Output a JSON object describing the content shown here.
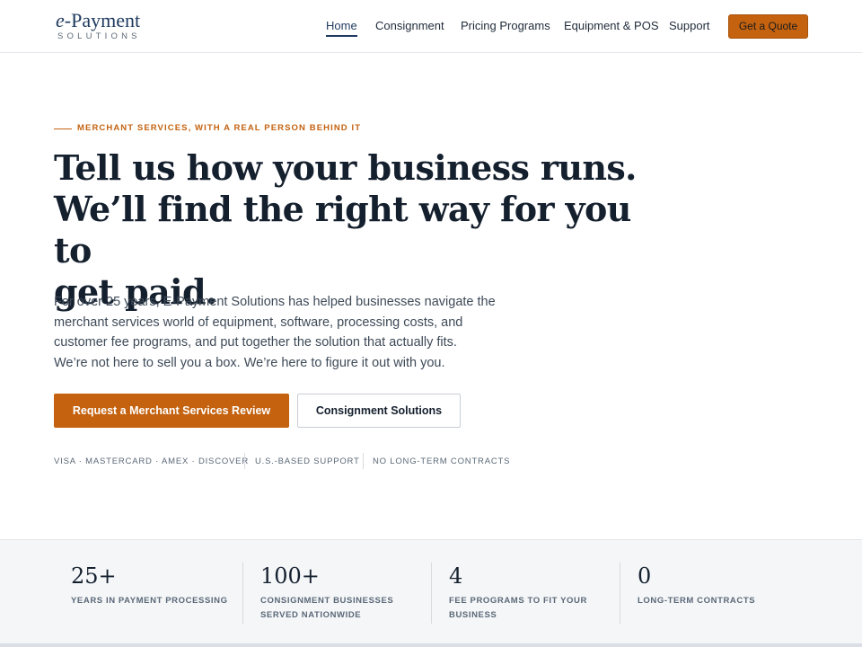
{
  "brand": {
    "logo_prefix": "e",
    "logo_main": "-Payment",
    "logo_sub": "SOLUTIONS"
  },
  "nav": {
    "items": [
      {
        "label": "Home",
        "active": true
      },
      {
        "label": "Consignment",
        "active": false
      },
      {
        "label": "Pricing Programs",
        "active": false
      },
      {
        "label": "Equipment & POS",
        "active": false
      },
      {
        "label": "Support",
        "active": false
      }
    ],
    "cta_label": "Get a Quote"
  },
  "hero": {
    "eyebrow": "MERCHANT SERVICES, WITH A REAL PERSON BEHIND IT",
    "headline_lines": [
      "Tell us how your business runs.",
      "We’ll find the right way for you to",
      "get paid."
    ],
    "body_lines": [
      "For over 25 years, E-Payment Solutions has helped businesses navigate the",
      "merchant services world of equipment, software, processing costs, and",
      "customer fee programs, and put together the solution that actually fits.",
      "We’re not here to sell you a box. We’re here to figure it out with you."
    ],
    "primary_button": "Request a Merchant Services Review",
    "secondary_button": "Consignment Solutions",
    "badges": [
      "VISA · MASTERCARD · AMEX · DISCOVER",
      "U.S.-BASED SUPPORT",
      "NO LONG-TERM CONTRACTS"
    ]
  },
  "stats": [
    {
      "value": "25+",
      "label_lines": [
        "YEARS IN PAYMENT PROCESSING"
      ]
    },
    {
      "value": "100+",
      "label_lines": [
        "CONSIGNMENT BUSINESSES",
        "SERVED NATIONWIDE"
      ]
    },
    {
      "value": "4",
      "label_lines": [
        "FEE PROGRAMS TO FIT YOUR",
        "BUSINESS"
      ]
    },
    {
      "value": "0",
      "label_lines": [
        "LONG-TERM CONTRACTS"
      ]
    }
  ],
  "colors": {
    "accent": "#c4620f",
    "navy": "#1f3a5f",
    "text_dark": "#15202e",
    "text_muted": "#5b6877",
    "band_bg": "#f4f6f8"
  }
}
